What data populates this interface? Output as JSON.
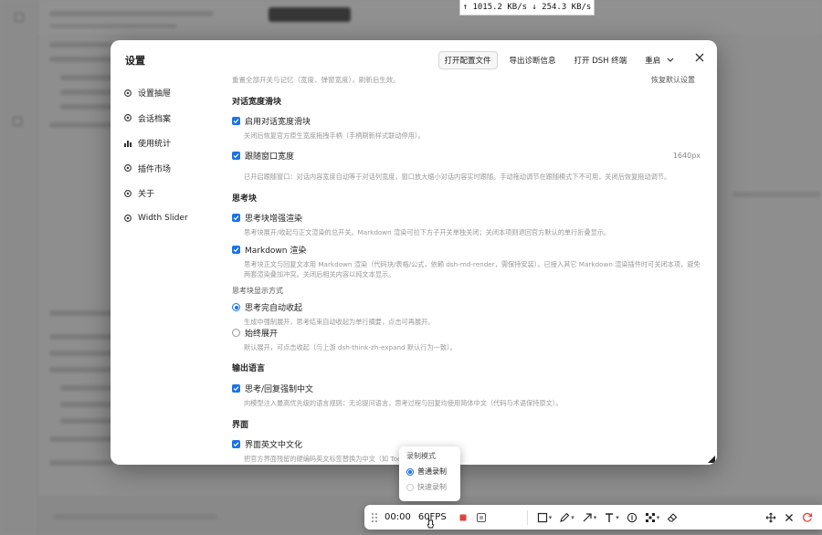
{
  "net_speed": {
    "up": "↑ 1015.2 KB/s",
    "down": "↓ 254.3 KB/s"
  },
  "dialog": {
    "title": "设置",
    "actions": {
      "open_config": "打开配置文件",
      "export_diag": "导出诊断信息",
      "open_terminal": "打开 DSH 终端",
      "restart": "重启"
    }
  },
  "sidebar": {
    "items": [
      {
        "label": "设置抽屉",
        "icon": "gear-icon"
      },
      {
        "label": "会话档案",
        "icon": "gear-icon"
      },
      {
        "label": "使用统计",
        "icon": "bar-chart-icon"
      },
      {
        "label": "插件市场",
        "icon": "gear-icon"
      },
      {
        "label": "关于",
        "icon": "gear-icon"
      },
      {
        "label": "Width Slider",
        "icon": "gear-icon"
      }
    ]
  },
  "content": {
    "intro": "重置全部开关与记忆（宽度、弹窗宽度），刷新后生效。",
    "reset_link": "恢复默认设置",
    "sec_width": "对话宽度滑块",
    "opt_enable_slider": {
      "label": "启用对话宽度滑块",
      "desc": "关闭后恢复官方原生宽度拖拽手柄（手柄刷新样式联动停用）。"
    },
    "opt_follow_window": {
      "label": "跟随窗口宽度",
      "value": "1640px",
      "desc": "已开启跟随窗口：对话内容宽度自动等于对话列宽度，窗口放大缩小对话内容实时跟随。手动拖动调节在跟随模式下不可用，关闭后恢复拖动调节。"
    },
    "sec_think": "思考块",
    "opt_think_enhance": {
      "label": "思考块增强渲染",
      "desc": "思考块展开/收起与正文渲染的总开关。Markdown 渲染可拉下方子开关单独关闭；关闭本项则退回官方默认的单行折叠显示。"
    },
    "opt_markdown": {
      "label": "Markdown 渲染",
      "desc1": "思考块正文与回复文本用 Markdown 渲染（代码块/表格/公式，依赖 dsh-md-render，需保持安装）。已接入其它 Markdown 渲染插件时可关闭本项，避免",
      "desc2": "两套渲染叠加冲突。关闭后相关内容以纯文本显示。"
    },
    "display_mode_label": "思考块显示方式",
    "radio_auto_collapse": {
      "label": "思考完自动收起",
      "desc": "生成中强制展开，思考结束自动收起为单行摘要，点击可再展开。"
    },
    "radio_always_expand": {
      "label": "始终展开",
      "desc": "默认展开，可点击收起（与上游 dsh-think-zh-expand 默认行为一致）。"
    },
    "sec_output_lang": "输出语言",
    "opt_force_chinese": {
      "label": "思考/回复强制中文",
      "desc": "向模型注入最高优先级的语言规则：无论提问语言，思考过程与回复均使用简体中文（代码与术语保持原文）。"
    },
    "sec_ui": "界面",
    "opt_ui_chinese": {
      "label": "界面英文中文化",
      "desc": "把官方界面残留的硬编码英文标签替换为中文（如 Tool ... king→思考）。"
    }
  },
  "record_popup": {
    "title": "录制模式",
    "options": [
      {
        "label": "普通录制",
        "selected": true
      },
      {
        "label": "快速录制",
        "selected": false
      }
    ]
  },
  "toolbar": {
    "time": "00:00",
    "fps": "60FPS"
  },
  "colors": {
    "accent": "#1a73e8",
    "record_red": "#e0443c"
  }
}
